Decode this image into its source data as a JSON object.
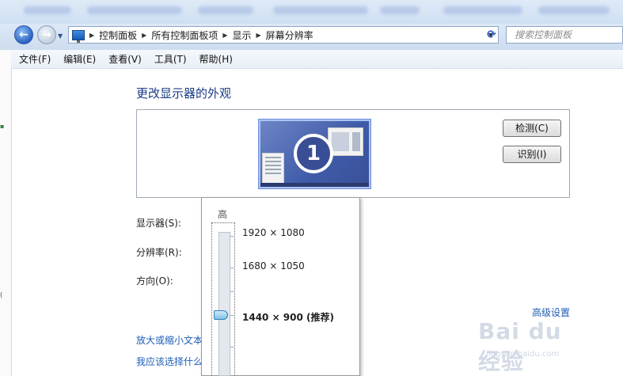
{
  "addressbar": {
    "crumbs": [
      "控制面板",
      "所有控制面板项",
      "显示",
      "屏幕分辨率"
    ],
    "search_placeholder": "搜索控制面板"
  },
  "menu": {
    "items": [
      "文件(F)",
      "编辑(E)",
      "查看(V)",
      "工具(T)",
      "帮助(H)"
    ]
  },
  "main": {
    "title": "更改显示器的外观",
    "monitor_number": "1",
    "detect_label": "检测(C)",
    "identify_label": "识别(I)",
    "display_label": "显示器(S):",
    "resolution_label": "分辨率(R):",
    "orientation_label": "方向(O):",
    "advanced_link": "高级设置",
    "text_size_link": "放大或缩小文本",
    "which_settings_link": "我应该选择什么"
  },
  "resolution_dropdown": {
    "high_label": "高",
    "options": [
      "1920 × 1080",
      "1680 × 1050",
      "1440 × 900 (推荐)"
    ],
    "selected": "1440 × 900 (推荐)"
  },
  "watermark": {
    "logo": "Bai du 经验",
    "url": "jingyan.baidu.com"
  },
  "colors": {
    "title_blue": "#1a3a86",
    "link_blue": "#1e5db5",
    "monitor_blue": "#3f5ba8"
  }
}
